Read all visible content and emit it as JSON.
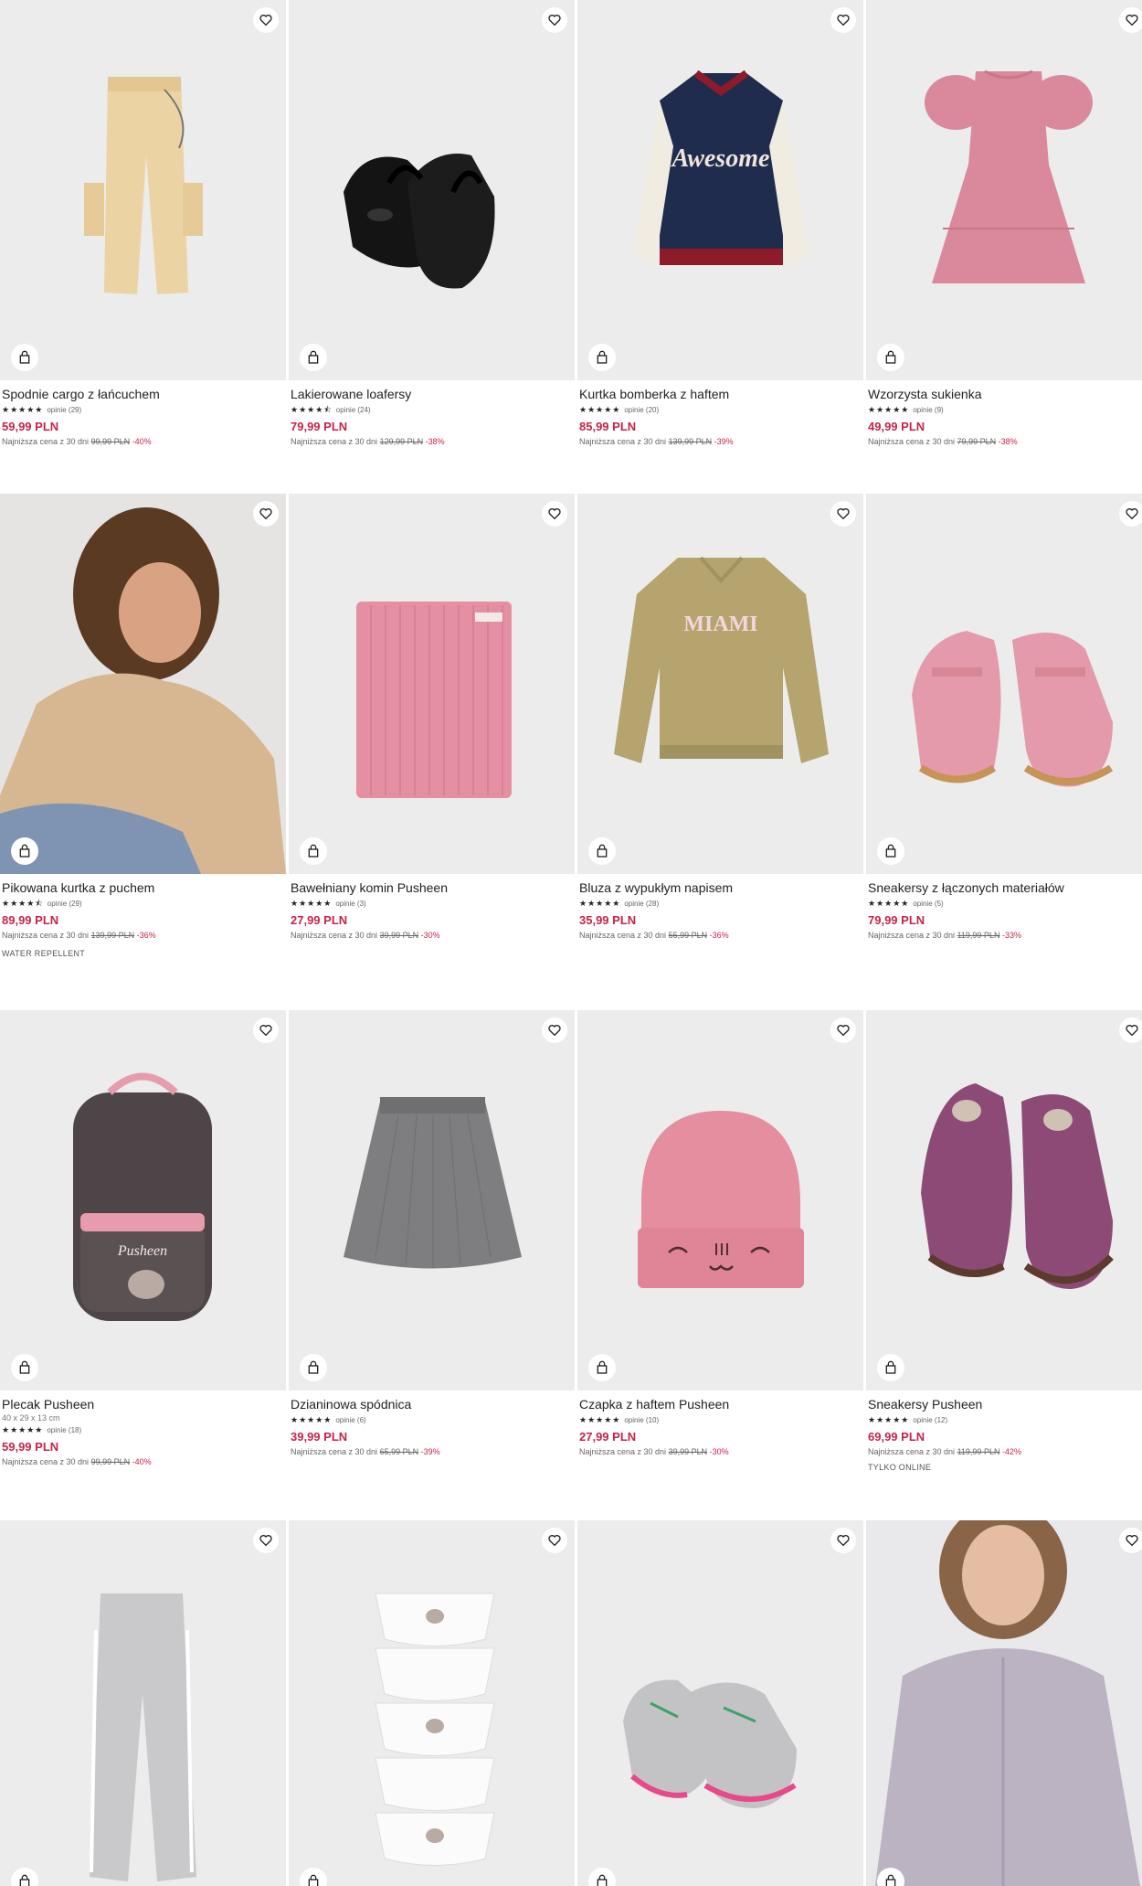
{
  "products": [
    {
      "name": "Spodnie cargo z łańcuchem",
      "reviews": "opinie (29)",
      "stars": "★★★★★",
      "price": "59,99 PLN",
      "lowest_label": "Najniższa cena z 30 dni",
      "old_price": "99,99 PLN",
      "discount": "-40%",
      "image": "beige-cargo-pants"
    },
    {
      "name": "Lakierowane loafersy",
      "reviews": "opinie (24)",
      "stars": "★★★★⯪",
      "price": "79,99 PLN",
      "lowest_label": "Najniższa cena z 30 dni",
      "old_price": "129,99 PLN",
      "discount": "-38%",
      "image": "black-patent-loafers"
    },
    {
      "name": "Kurtka bomberka z haftem",
      "reviews": "opinie (20)",
      "stars": "★★★★★",
      "price": "85,99 PLN",
      "lowest_label": "Najniższa cena z 30 dni",
      "old_price": "139,99 PLN",
      "discount": "-39%",
      "image": "bomber-jacket",
      "print": "Awesome"
    },
    {
      "name": "Wzorzysta sukienka",
      "reviews": "opinie (9)",
      "stars": "★★★★★",
      "price": "49,99 PLN",
      "lowest_label": "Najniższa cena z 30 dni",
      "old_price": "79,99 PLN",
      "discount": "-38%",
      "image": "pink-dress"
    },
    {
      "name": "Pikowana kurtka z puchem",
      "reviews": "opinie (29)",
      "stars": "★★★★⯪",
      "price": "89,99 PLN",
      "lowest_label": "Najniższa cena z 30 dni",
      "old_price": "139,99 PLN",
      "discount": "-36%",
      "tag": "WATER REPELLENT",
      "image": "child-in-puffer-jacket"
    },
    {
      "name": "Bawełniany komin Pusheen",
      "reviews": "opinie (3)",
      "stars": "★★★★★",
      "price": "27,99 PLN",
      "lowest_label": "Najniższa cena z 30 dni",
      "old_price": "39,99 PLN",
      "discount": "-30%",
      "image": "pink-snood"
    },
    {
      "name": "Bluza z wypukłym napisem",
      "reviews": "opinie (28)",
      "stars": "★★★★★",
      "price": "35,99 PLN",
      "lowest_label": "Najniższa cena z 30 dni",
      "old_price": "55,99 PLN",
      "discount": "-36%",
      "image": "miami-sweatshirt",
      "print": "MIAMI"
    },
    {
      "name": "Sneakersy z łączonych materiałów",
      "reviews": "opinie (5)",
      "stars": "★★★★★",
      "price": "79,99 PLN",
      "lowest_label": "Najniższa cena z 30 dni",
      "old_price": "119,99 PLN",
      "discount": "-33%",
      "image": "pink-sneakers"
    },
    {
      "name": "Plecak Pusheen",
      "dims": "40 x 29 x 13 cm",
      "reviews": "opinie (18)",
      "stars": "★★★★★",
      "price": "59,99 PLN",
      "lowest_label": "Najniższa cena z 30 dni",
      "old_price": "99,99 PLN",
      "discount": "-40%",
      "image": "pusheen-backpack",
      "print": "Pusheen"
    },
    {
      "name": "Dzianinowa spódnica",
      "reviews": "opinie (6)",
      "stars": "★★★★★",
      "price": "39,99 PLN",
      "lowest_label": "Najniższa cena z 30 dni",
      "old_price": "65,99 PLN",
      "discount": "-39%",
      "image": "grey-knit-skirt"
    },
    {
      "name": "Czapka z haftem Pusheen",
      "reviews": "opinie (10)",
      "stars": "★★★★★",
      "price": "27,99 PLN",
      "lowest_label": "Najniższa cena z 30 dni",
      "old_price": "39,99 PLN",
      "discount": "-30%",
      "image": "pink-beanie"
    },
    {
      "name": "Sneakersy Pusheen",
      "reviews": "opinie (12)",
      "stars": "★★★★★",
      "price": "69,99 PLN",
      "lowest_label": "Najniższa cena z 30 dni",
      "old_price": "119,99 PLN",
      "discount": "-42%",
      "tag": "TYLKO ONLINE",
      "image": "purple-sneakers"
    },
    {
      "image": "grey-flared-leggings"
    },
    {
      "image": "pusheen-briefs-pack"
    },
    {
      "image": "grey-pink-sneakers"
    },
    {
      "image": "girl-in-lilac-hoodie"
    }
  ],
  "icons": {
    "favorite": "heart-icon",
    "cart": "shopping-bag-icon"
  },
  "colors": {
    "price": "#c8234a",
    "image_bg": "#ececed"
  }
}
